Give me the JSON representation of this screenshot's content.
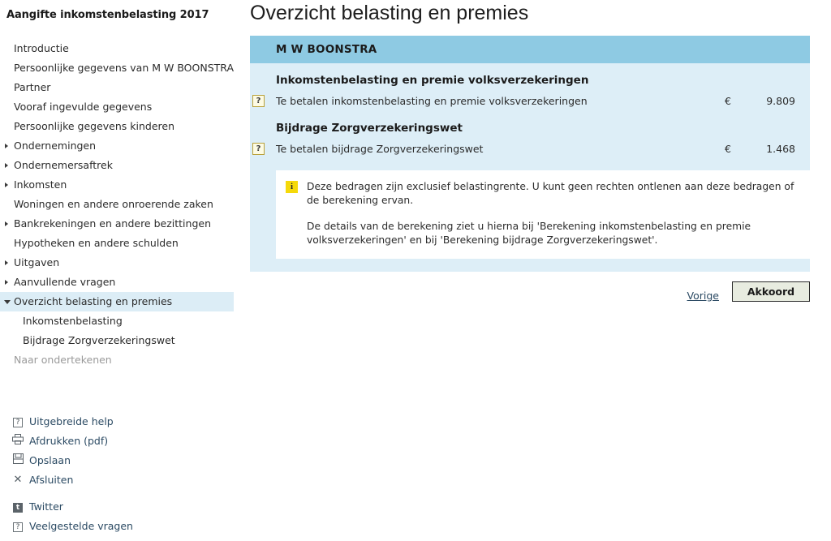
{
  "sidebar": {
    "title": "Aangifte inkomstenbelasting 2017",
    "nav_items": [
      {
        "label": "Introductie",
        "level": 1,
        "marker": "none",
        "state": "normal"
      },
      {
        "label": "Persoonlijke gegevens van M W BOONSTRA",
        "level": 1,
        "marker": "none",
        "state": "normal"
      },
      {
        "label": "Partner",
        "level": 1,
        "marker": "none",
        "state": "normal"
      },
      {
        "label": "Vooraf ingevulde gegevens",
        "level": 1,
        "marker": "none",
        "state": "normal"
      },
      {
        "label": "Persoonlijke gegevens kinderen",
        "level": 1,
        "marker": "none",
        "state": "normal"
      },
      {
        "label": "Ondernemingen",
        "level": 1,
        "marker": "collapsed",
        "state": "normal"
      },
      {
        "label": "Ondernemersaftrek",
        "level": 1,
        "marker": "collapsed",
        "state": "normal"
      },
      {
        "label": "Inkomsten",
        "level": 1,
        "marker": "collapsed",
        "state": "normal"
      },
      {
        "label": "Woningen en andere onroerende zaken",
        "level": 1,
        "marker": "none",
        "state": "normal"
      },
      {
        "label": "Bankrekeningen en andere bezittingen",
        "level": 1,
        "marker": "collapsed",
        "state": "normal"
      },
      {
        "label": "Hypotheken en andere schulden",
        "level": 1,
        "marker": "none",
        "state": "normal"
      },
      {
        "label": "Uitgaven",
        "level": 1,
        "marker": "collapsed",
        "state": "normal"
      },
      {
        "label": "Aanvullende vragen",
        "level": 1,
        "marker": "collapsed",
        "state": "normal"
      },
      {
        "label": "Overzicht belasting en premies",
        "level": 1,
        "marker": "expanded",
        "state": "selected"
      },
      {
        "label": "Inkomstenbelasting",
        "level": 2,
        "marker": "none",
        "state": "normal"
      },
      {
        "label": "Bijdrage Zorgverzekeringswet",
        "level": 2,
        "marker": "none",
        "state": "normal"
      },
      {
        "label": "Naar ondertekenen",
        "level": 1,
        "marker": "none",
        "state": "disabled"
      }
    ],
    "tool_links": [
      {
        "label": "Uitgebreide help",
        "icon": "help-question-icon",
        "glyph": "?",
        "style": "box"
      },
      {
        "label": "Afdrukken (pdf)",
        "icon": "printer-icon",
        "glyph": "⎙",
        "style": "plain"
      },
      {
        "label": "Opslaan",
        "icon": "save-floppy-icon",
        "glyph": "Ὃe",
        "style": "floppy"
      },
      {
        "label": "Afsluiten",
        "icon": "close-x-icon",
        "glyph": "✕",
        "style": "plain"
      },
      {
        "label": "Twitter",
        "icon": "twitter-icon",
        "glyph": "t",
        "style": "twitter"
      },
      {
        "label": "Veelgestelde vragen",
        "icon": "faq-question-icon",
        "glyph": "?",
        "style": "box"
      }
    ]
  },
  "main": {
    "page_title": "Overzicht belasting en premies",
    "panel_header": "M W BOONSTRA",
    "sections": [
      {
        "heading": "Inkomstenbelasting en premie volksverzekeringen",
        "row": {
          "help_icon_label": "?",
          "label": "Te betalen inkomstenbelasting en premie volksverzekeringen",
          "currency": "€",
          "amount": "9.809"
        }
      },
      {
        "heading": "Bijdrage Zorgverzekeringswet",
        "row": {
          "help_icon_label": "?",
          "label": "Te betalen bijdrage Zorgverzekeringswet",
          "currency": "€",
          "amount": "1.468"
        }
      }
    ],
    "info_box": {
      "icon_label": "i",
      "paragraph_1": "Deze bedragen zijn exclusief belastingrente. U kunt geen rechten ontlenen aan deze bedragen of de berekening ervan.",
      "paragraph_2": "De details van de berekening ziet u hierna bij 'Berekening inkomstenbelasting en premie volksverzekeringen' en bij 'Berekening bijdrage Zorgverzekeringswet'."
    },
    "actions": {
      "previous_label": "Vorige",
      "agree_label": "Akkoord"
    }
  },
  "colors": {
    "panel_header_bg": "#8ecae3",
    "panel_body_bg": "#ddeef7",
    "selected_nav_bg": "#dcedf6",
    "link_text": "#2b4a63",
    "help_icon_bg": "#fdfbe4",
    "help_icon_border": "#b9a13a",
    "info_icon_bg": "#f5d90a",
    "button_bg": "#e8ece0"
  }
}
